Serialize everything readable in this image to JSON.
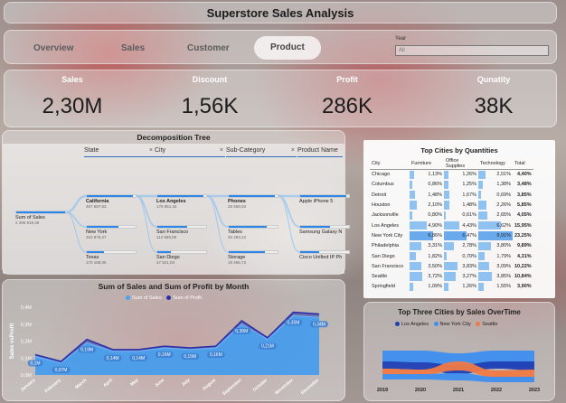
{
  "title": "Superstore Sales Analysis",
  "nav": {
    "items": [
      "Overview",
      "Sales",
      "Customer",
      "Product"
    ],
    "active": "Product",
    "year_label": "Year",
    "year_value": "All"
  },
  "kpis": [
    {
      "label": "Sales",
      "value": "2,30M"
    },
    {
      "label": "Discount",
      "value": "1,56K"
    },
    {
      "label": "Profit",
      "value": "286K"
    },
    {
      "label": "Qunatity",
      "value": "38K"
    }
  ],
  "decomposition": {
    "title": "Decomposition Tree",
    "columns": [
      "State",
      "City",
      "Sub-Category",
      "Product Name"
    ],
    "root": {
      "name": "Sum of Sales",
      "value": "2 296 919,49",
      "fill": 1.0
    },
    "levels": [
      [
        {
          "name": "California",
          "value": "457 687,63",
          "fill": 0.95,
          "bold": true
        },
        {
          "name": "New York",
          "value": "310 876,27",
          "fill": 0.65
        },
        {
          "name": "Texas",
          "value": "170 188,05",
          "fill": 0.36
        }
      ],
      [
        {
          "name": "Los Angeles",
          "value": "175 851,34",
          "fill": 0.95,
          "bold": true
        },
        {
          "name": "San Francisco",
          "value": "112 669,09",
          "fill": 0.62
        },
        {
          "name": "San Diego",
          "value": "47 521,03",
          "fill": 0.27
        }
      ],
      [
        {
          "name": "Phones",
          "value": "25 569,03",
          "fill": 0.95,
          "bold": true
        },
        {
          "name": "Tables",
          "value": "20 483,12",
          "fill": 0.78
        },
        {
          "name": "Storage",
          "value": "19 465,73",
          "fill": 0.74
        }
      ],
      [
        {
          "name": "Apple iPhone 5",
          "value": "",
          "fill": 0.95
        },
        {
          "name": "Samsung Galaxy N",
          "value": "",
          "fill": 0.62
        },
        {
          "name": "Cisco Unified IP Ph",
          "value": "",
          "fill": 0.38
        }
      ]
    ]
  },
  "top_cities": {
    "title": "Top Cities by Quantities",
    "headers": [
      "City",
      "Furniture",
      "Office Supplies",
      "Technology",
      "Total"
    ],
    "rows": [
      {
        "city": "Chicago",
        "furniture": "1,13%",
        "office": "1,26%",
        "tech": "2,01%",
        "total": "4,40%",
        "f": 0.12,
        "o": 0.13,
        "t": 0.2
      },
      {
        "city": "Columbus",
        "furniture": "0,86%",
        "office": "1,25%",
        "tech": "1,38%",
        "total": "3,48%",
        "f": 0.09,
        "o": 0.13,
        "t": 0.14
      },
      {
        "city": "Detroit",
        "furniture": "1,48%",
        "office": "1,67%",
        "tech": "0,69%",
        "total": "3,85%",
        "f": 0.15,
        "o": 0.17,
        "t": 0.07
      },
      {
        "city": "Houston",
        "furniture": "2,10%",
        "office": "1,48%",
        "tech": "2,26%",
        "total": "5,85%",
        "f": 0.21,
        "o": 0.15,
        "t": 0.23
      },
      {
        "city": "Jacksonville",
        "furniture": "0,80%",
        "office": "0,61%",
        "tech": "2,65%",
        "total": "4,05%",
        "f": 0.08,
        "o": 0.06,
        "t": 0.27
      },
      {
        "city": "Los Angeles",
        "furniture": "4,90%",
        "office": "4,43%",
        "tech": "6,62%",
        "total": "15,95%",
        "f": 0.5,
        "o": 0.45,
        "t": 0.67
      },
      {
        "city": "New York City",
        "furniture": "6,86%",
        "office": "6,47%",
        "tech": "9,91%",
        "total": "23,25%",
        "f": 0.69,
        "o": 0.65,
        "t": 1.0
      },
      {
        "city": "Philadelphia",
        "furniture": "3,31%",
        "office": "2,78%",
        "tech": "3,80%",
        "total": "9,89%",
        "f": 0.34,
        "o": 0.28,
        "t": 0.38
      },
      {
        "city": "San Diego",
        "furniture": "1,82%",
        "office": "0,70%",
        "tech": "1,79%",
        "total": "4,31%",
        "f": 0.18,
        "o": 0.07,
        "t": 0.18
      },
      {
        "city": "San Francisco",
        "furniture": "3,50%",
        "office": "3,83%",
        "tech": "3,09%",
        "total": "10,22%",
        "f": 0.35,
        "o": 0.39,
        "t": 0.31
      },
      {
        "city": "Seattle",
        "furniture": "3,72%",
        "office": "3,27%",
        "tech": "3,85%",
        "total": "10,84%",
        "f": 0.38,
        "o": 0.33,
        "t": 0.39
      },
      {
        "city": "Springfield",
        "furniture": "1,09%",
        "office": "1,26%",
        "tech": "1,55%",
        "total": "3,90%",
        "f": 0.11,
        "o": 0.13,
        "t": 0.16
      }
    ]
  },
  "chart_data": [
    {
      "type": "area",
      "title": "Sum of Sales and Sum of Profit by Month",
      "ylabel": "Sales vsProfit",
      "xlabel": "",
      "ylim": [
        0,
        0.4
      ],
      "yticks": [
        "0,0M",
        "0,1M",
        "0,2M",
        "0,3M",
        "0,4M"
      ],
      "categories": [
        "January",
        "February",
        "March",
        "April",
        "May",
        "June",
        "July",
        "August",
        "September",
        "October",
        "November",
        "December"
      ],
      "series": [
        {
          "name": "Sum of Sales",
          "color": "#4aa3f0",
          "values": [
            0.11,
            0.07,
            0.19,
            0.14,
            0.14,
            0.16,
            0.15,
            0.16,
            0.3,
            0.21,
            0.35,
            0.34
          ]
        },
        {
          "name": "Sum of Profit",
          "color": "#2a2fa8",
          "values": [
            0.12,
            0.08,
            0.21,
            0.15,
            0.15,
            0.17,
            0.16,
            0.17,
            0.32,
            0.22,
            0.37,
            0.36
          ]
        }
      ],
      "data_labels": [
        "0,1M",
        "0,07M",
        "0,19M",
        "0,14M",
        "0,14M",
        "0,16M",
        "0,15M",
        "0,16M",
        "0,30M",
        "0,21M",
        "0,35M",
        "0,34M"
      ],
      "legend_position": "top"
    },
    {
      "type": "area",
      "title": "Top Three Cities by Sales OverTime",
      "categories": [
        "2019",
        "2020",
        "2021",
        "2022",
        "2023"
      ],
      "series": [
        {
          "name": "Los Angeles",
          "color": "#1f3fb5"
        },
        {
          "name": "New York City",
          "color": "#3d8ff0"
        },
        {
          "name": "Seattle",
          "color": "#f07a45"
        }
      ],
      "legend_position": "top"
    }
  ]
}
